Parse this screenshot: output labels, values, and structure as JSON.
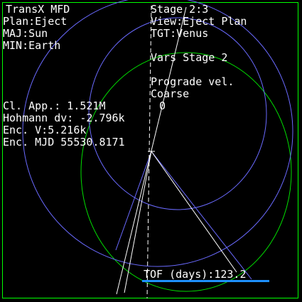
{
  "mfd": {
    "title": "TransX MFD",
    "plan": "Plan:Eject",
    "major": "MAJ:Sun",
    "minor": "MIN:Earth",
    "stage": "Stage 2:3",
    "view": "View:Eject Plan",
    "target": "TGT:Venus",
    "vars_stage": "Vars Stage 2",
    "variable_name": "Prograde vel.",
    "adjust_mode": "Coarse",
    "variable_value": "0",
    "closest_approach": "Cl. App.: 1.521M",
    "hohmann_dv": "Hohmann dv: -2.796k",
    "encounter_velocity": "Enc. V:5.216k",
    "encounter_mjd": "Enc. MJD 55530.8171",
    "time_of_flight": "TOF (days):123.2"
  },
  "colors": {
    "background": "#000000",
    "text": "#ffffff",
    "frame": "#00ff00",
    "orbit_green": "#00dd00",
    "orbit_blue": "#6a6aff",
    "highlight_underline": "#1e90ff",
    "lines": "#ffffff"
  }
}
